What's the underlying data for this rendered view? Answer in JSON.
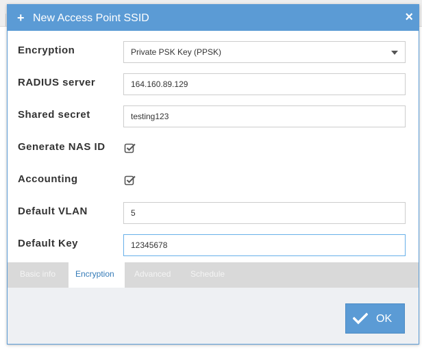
{
  "dialog": {
    "title": "New Access Point SSID",
    "plus_glyph": "+",
    "close_glyph": "×"
  },
  "form": {
    "encryption": {
      "label": "Encryption",
      "value": "Private PSK Key (PPSK)"
    },
    "radius_server": {
      "label": "RADIUS server",
      "value": "164.160.89.129"
    },
    "shared_secret": {
      "label": "Shared secret",
      "value": "testing123"
    },
    "generate_nas_id": {
      "label": "Generate NAS ID",
      "checked": true
    },
    "accounting": {
      "label": "Accounting",
      "checked": true
    },
    "default_vlan": {
      "label": "Default VLAN",
      "value": "5"
    },
    "default_key": {
      "label": "Default Key",
      "value": "12345678"
    }
  },
  "tabs": [
    {
      "label": "Basic info",
      "active": false
    },
    {
      "label": "Encryption",
      "active": true
    },
    {
      "label": "Advanced",
      "active": false
    },
    {
      "label": "Schedule",
      "active": false
    }
  ],
  "footer": {
    "ok_label": "OK"
  },
  "icons": {
    "title": "plus-icon",
    "close": "close-icon",
    "checkbox": "checkbox-checked-icon",
    "dropdown": "caret-down-icon",
    "ok": "checkmark-icon"
  },
  "colors": {
    "accent": "#5b9bd5",
    "tab_active_text": "#337ab7",
    "tab_strip": "#d9d9d9"
  }
}
